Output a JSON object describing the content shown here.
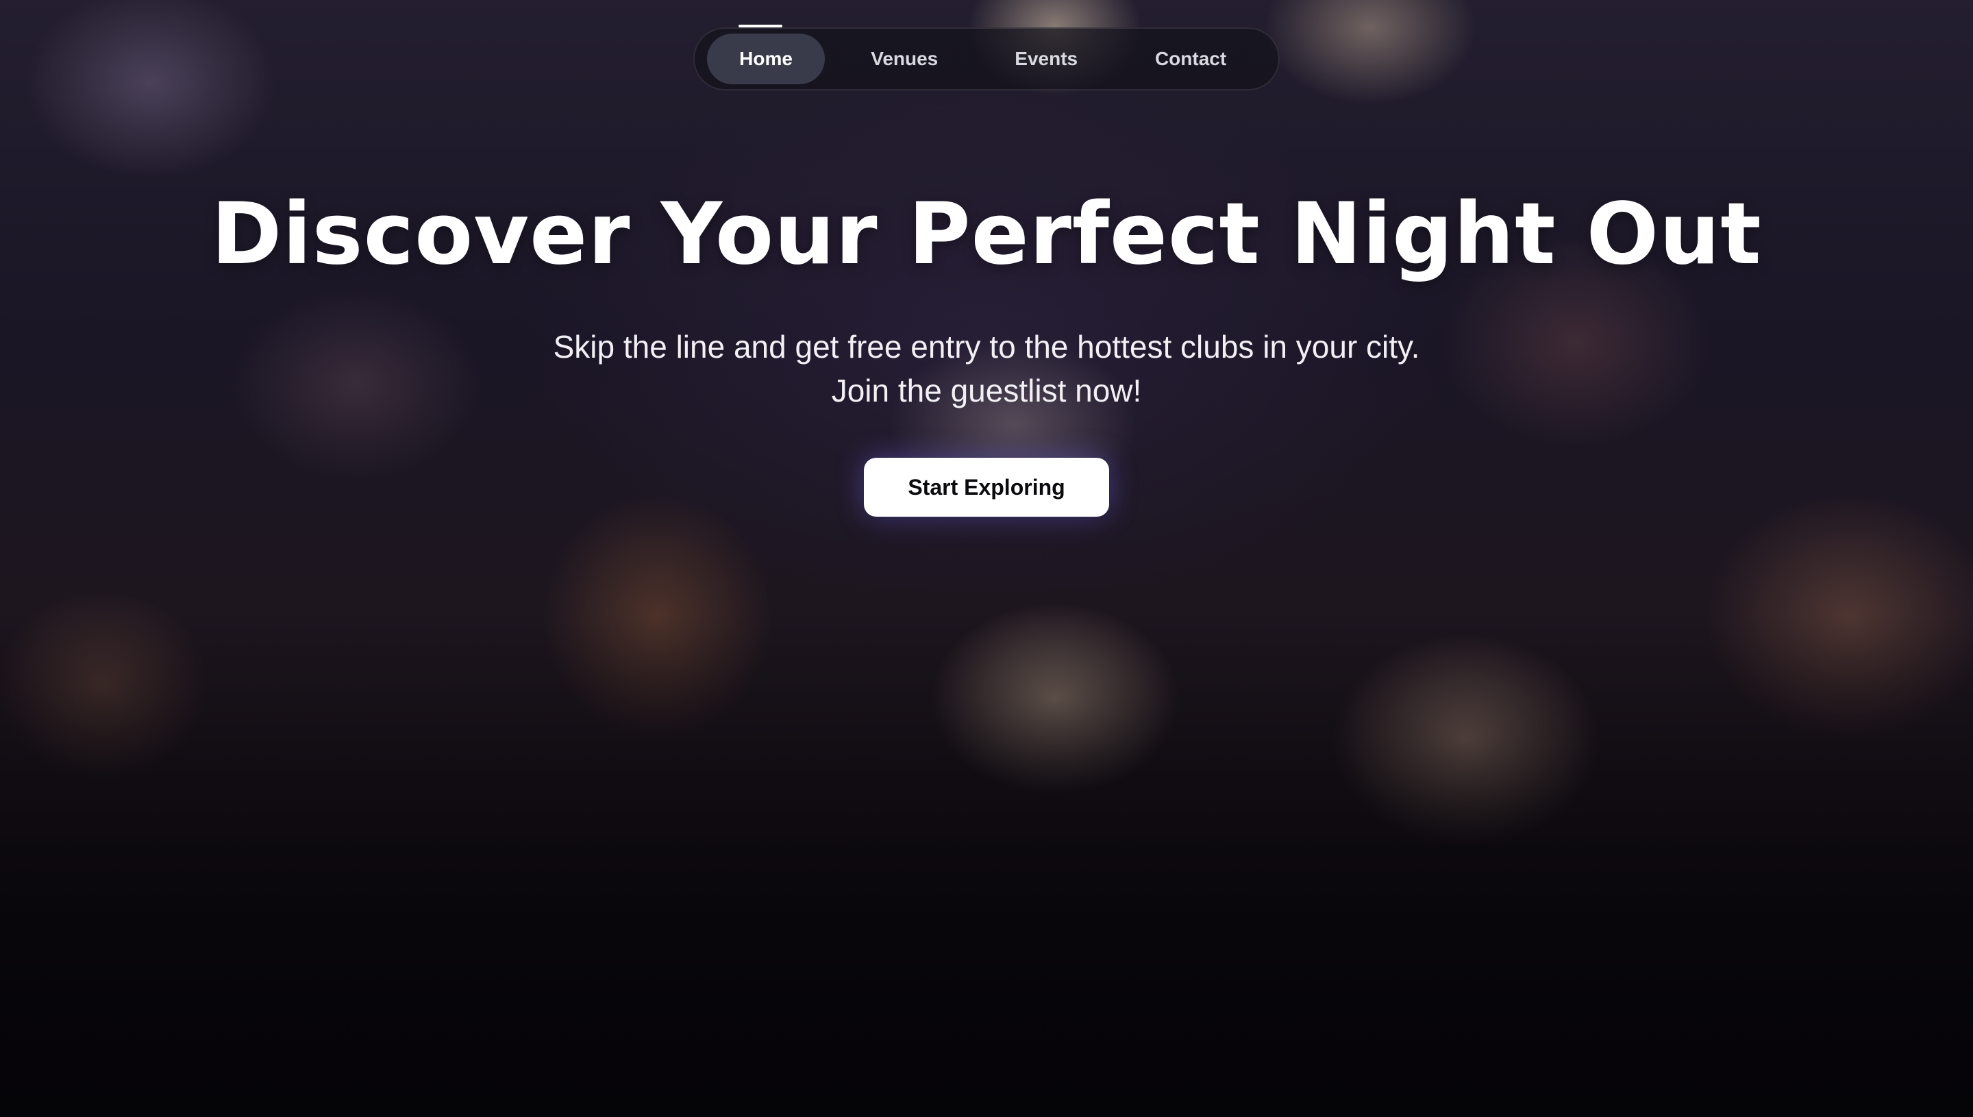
{
  "nav": {
    "items": [
      {
        "label": "Home",
        "active": true
      },
      {
        "label": "Venues",
        "active": false
      },
      {
        "label": "Events",
        "active": false
      },
      {
        "label": "Contact",
        "active": false
      }
    ]
  },
  "hero": {
    "title": "Discover Your Perfect Night Out",
    "subtitle_line1": "Skip the line and get free entry to the hottest clubs in your city.",
    "subtitle_line2": "Join the guestlist now!",
    "cta_label": "Start Exploring",
    "background": "nightclub-crowd-photo"
  },
  "colors": {
    "text": "#ffffff",
    "cta_background": "#ffffff",
    "cta_text": "#0b0b0f",
    "nav_background": "#14121c",
    "page_background": "#07050a"
  }
}
